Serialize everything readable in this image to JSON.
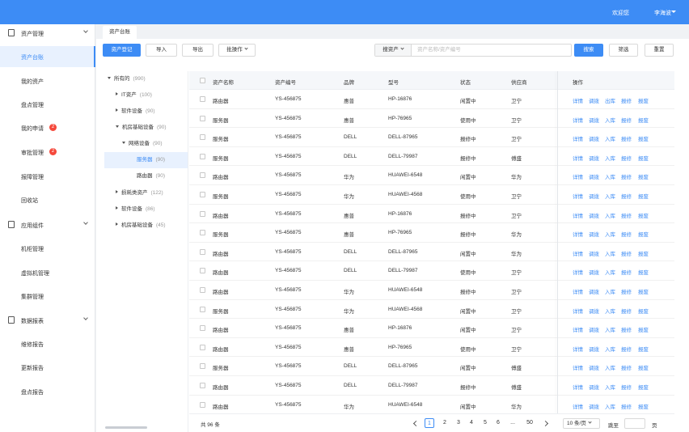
{
  "header": {
    "welcome": "欢迎您",
    "user": "李海波"
  },
  "tab": {
    "label": "资产台账"
  },
  "sidebar": {
    "groups": [
      {
        "label": "资产管理",
        "items": [
          {
            "label": "资产台账",
            "active": true
          },
          {
            "label": "我的资产"
          },
          {
            "label": "盘点管理"
          },
          {
            "label": "我的申请",
            "badge": "2"
          },
          {
            "label": "审批管理",
            "badge": "2"
          },
          {
            "label": "报障管理"
          },
          {
            "label": "回收站"
          }
        ]
      },
      {
        "label": "应用组件",
        "items": [
          {
            "label": "机柜管理"
          },
          {
            "label": "虚拟机管理"
          },
          {
            "label": "集群管理"
          }
        ]
      },
      {
        "label": "数据报表",
        "items": [
          {
            "label": "维修报告"
          },
          {
            "label": "更新报告"
          },
          {
            "label": "盘点报告"
          }
        ]
      }
    ]
  },
  "toolbar": {
    "register": "资产登记",
    "import": "导入",
    "export": "导出",
    "bulk": "批操作",
    "search_type": "搜资产",
    "search_placeholder": "资产名称/资产编号",
    "search": "搜索",
    "filter": "筛选",
    "reset": "重置"
  },
  "tree": {
    "root": {
      "label": "所有的",
      "count": "(990)"
    },
    "nodes": [
      {
        "label": "IT资产",
        "count": "(100)",
        "level": 1,
        "expanded": false
      },
      {
        "label": "软件设备",
        "count": "(90)",
        "level": 1,
        "expanded": false
      },
      {
        "label": "机房基础设备",
        "count": "(90)",
        "level": 1,
        "expanded": true
      },
      {
        "label": "网络设备",
        "count": "(90)",
        "level": 2,
        "expanded": true
      },
      {
        "label": "服务器",
        "count": "(90)",
        "level": 3,
        "selected": true
      },
      {
        "label": "路由器",
        "count": "(90)",
        "level": 3
      },
      {
        "label": "损耗类资产",
        "count": "(122)",
        "level": 1,
        "expanded": false
      },
      {
        "label": "软件设备",
        "count": "(86)",
        "level": 1,
        "expanded": false
      },
      {
        "label": "机房基础设备",
        "count": "(45)",
        "level": 1,
        "expanded": false
      }
    ]
  },
  "table": {
    "columns": [
      "资产名称",
      "资产编号",
      "品牌",
      "型号",
      "状态",
      "供应商",
      "操作"
    ],
    "rows": [
      [
        "路由器",
        "YS-456875",
        "惠普",
        "HP-16876",
        "闲置中",
        "卫宁"
      ],
      [
        "服务器",
        "YS-456875",
        "惠普",
        "HP-76965",
        "使用中",
        "卫宁"
      ],
      [
        "服务器",
        "YS-456875",
        "DELL",
        "DELL-87965",
        "报修中",
        "卫宁"
      ],
      [
        "服务器",
        "YS-456875",
        "DELL",
        "DELL-79987",
        "报修中",
        "傅盛"
      ],
      [
        "路由器",
        "YS-456875",
        "华为",
        "HUAWEI-6548",
        "闲置中",
        "华为"
      ],
      [
        "服务器",
        "YS-456875",
        "华为",
        "HUAWEI-4568",
        "使用中",
        "卫宁"
      ],
      [
        "路由器",
        "YS-456875",
        "惠普",
        "HP-16876",
        "报修中",
        "卫宁"
      ],
      [
        "服务器",
        "YS-456875",
        "惠普",
        "HP-76965",
        "报修中",
        "华为"
      ],
      [
        "路由器",
        "YS-456875",
        "DELL",
        "DELL-87965",
        "闲置中",
        "华为"
      ],
      [
        "路由器",
        "YS-456875",
        "DELL",
        "DELL-79987",
        "使用中",
        "卫宁"
      ],
      [
        "路由器",
        "YS-456875",
        "华为",
        "HUAWEI-6548",
        "报修中",
        "卫宁"
      ],
      [
        "服务器",
        "YS-456875",
        "华为",
        "HUAWEI-4568",
        "闲置中",
        "卫宁"
      ],
      [
        "路由器",
        "YS-456875",
        "惠普",
        "HP-16876",
        "闲置中",
        "卫宁"
      ],
      [
        "路由器",
        "YS-456875",
        "惠普",
        "HP-76965",
        "使用中",
        "卫宁"
      ],
      [
        "服务器",
        "YS-456875",
        "DELL",
        "DELL-87965",
        "闲置中",
        "傅盛"
      ],
      [
        "路由器",
        "YS-456875",
        "DELL",
        "DELL-79987",
        "报修中",
        "傅盛"
      ],
      [
        "路由器",
        "YS-456875",
        "华为",
        "HUAWEI-6548",
        "闲置中",
        "华为"
      ]
    ],
    "ops_first": [
      "详情",
      "调拨",
      "出库",
      "报修",
      "报废"
    ],
    "ops": [
      "详情",
      "调拨",
      "入库",
      "报修",
      "报废"
    ]
  },
  "pagination": {
    "total": "共 96 条",
    "pages": [
      "1",
      "2",
      "3",
      "4",
      "5",
      "6",
      "...",
      "50"
    ],
    "current": "1",
    "page_size": "10 条/页",
    "goto_label": "跳至",
    "page_suffix": "页"
  },
  "colors": {
    "primary": "#3d8cf5",
    "badge": "#f5483b"
  }
}
